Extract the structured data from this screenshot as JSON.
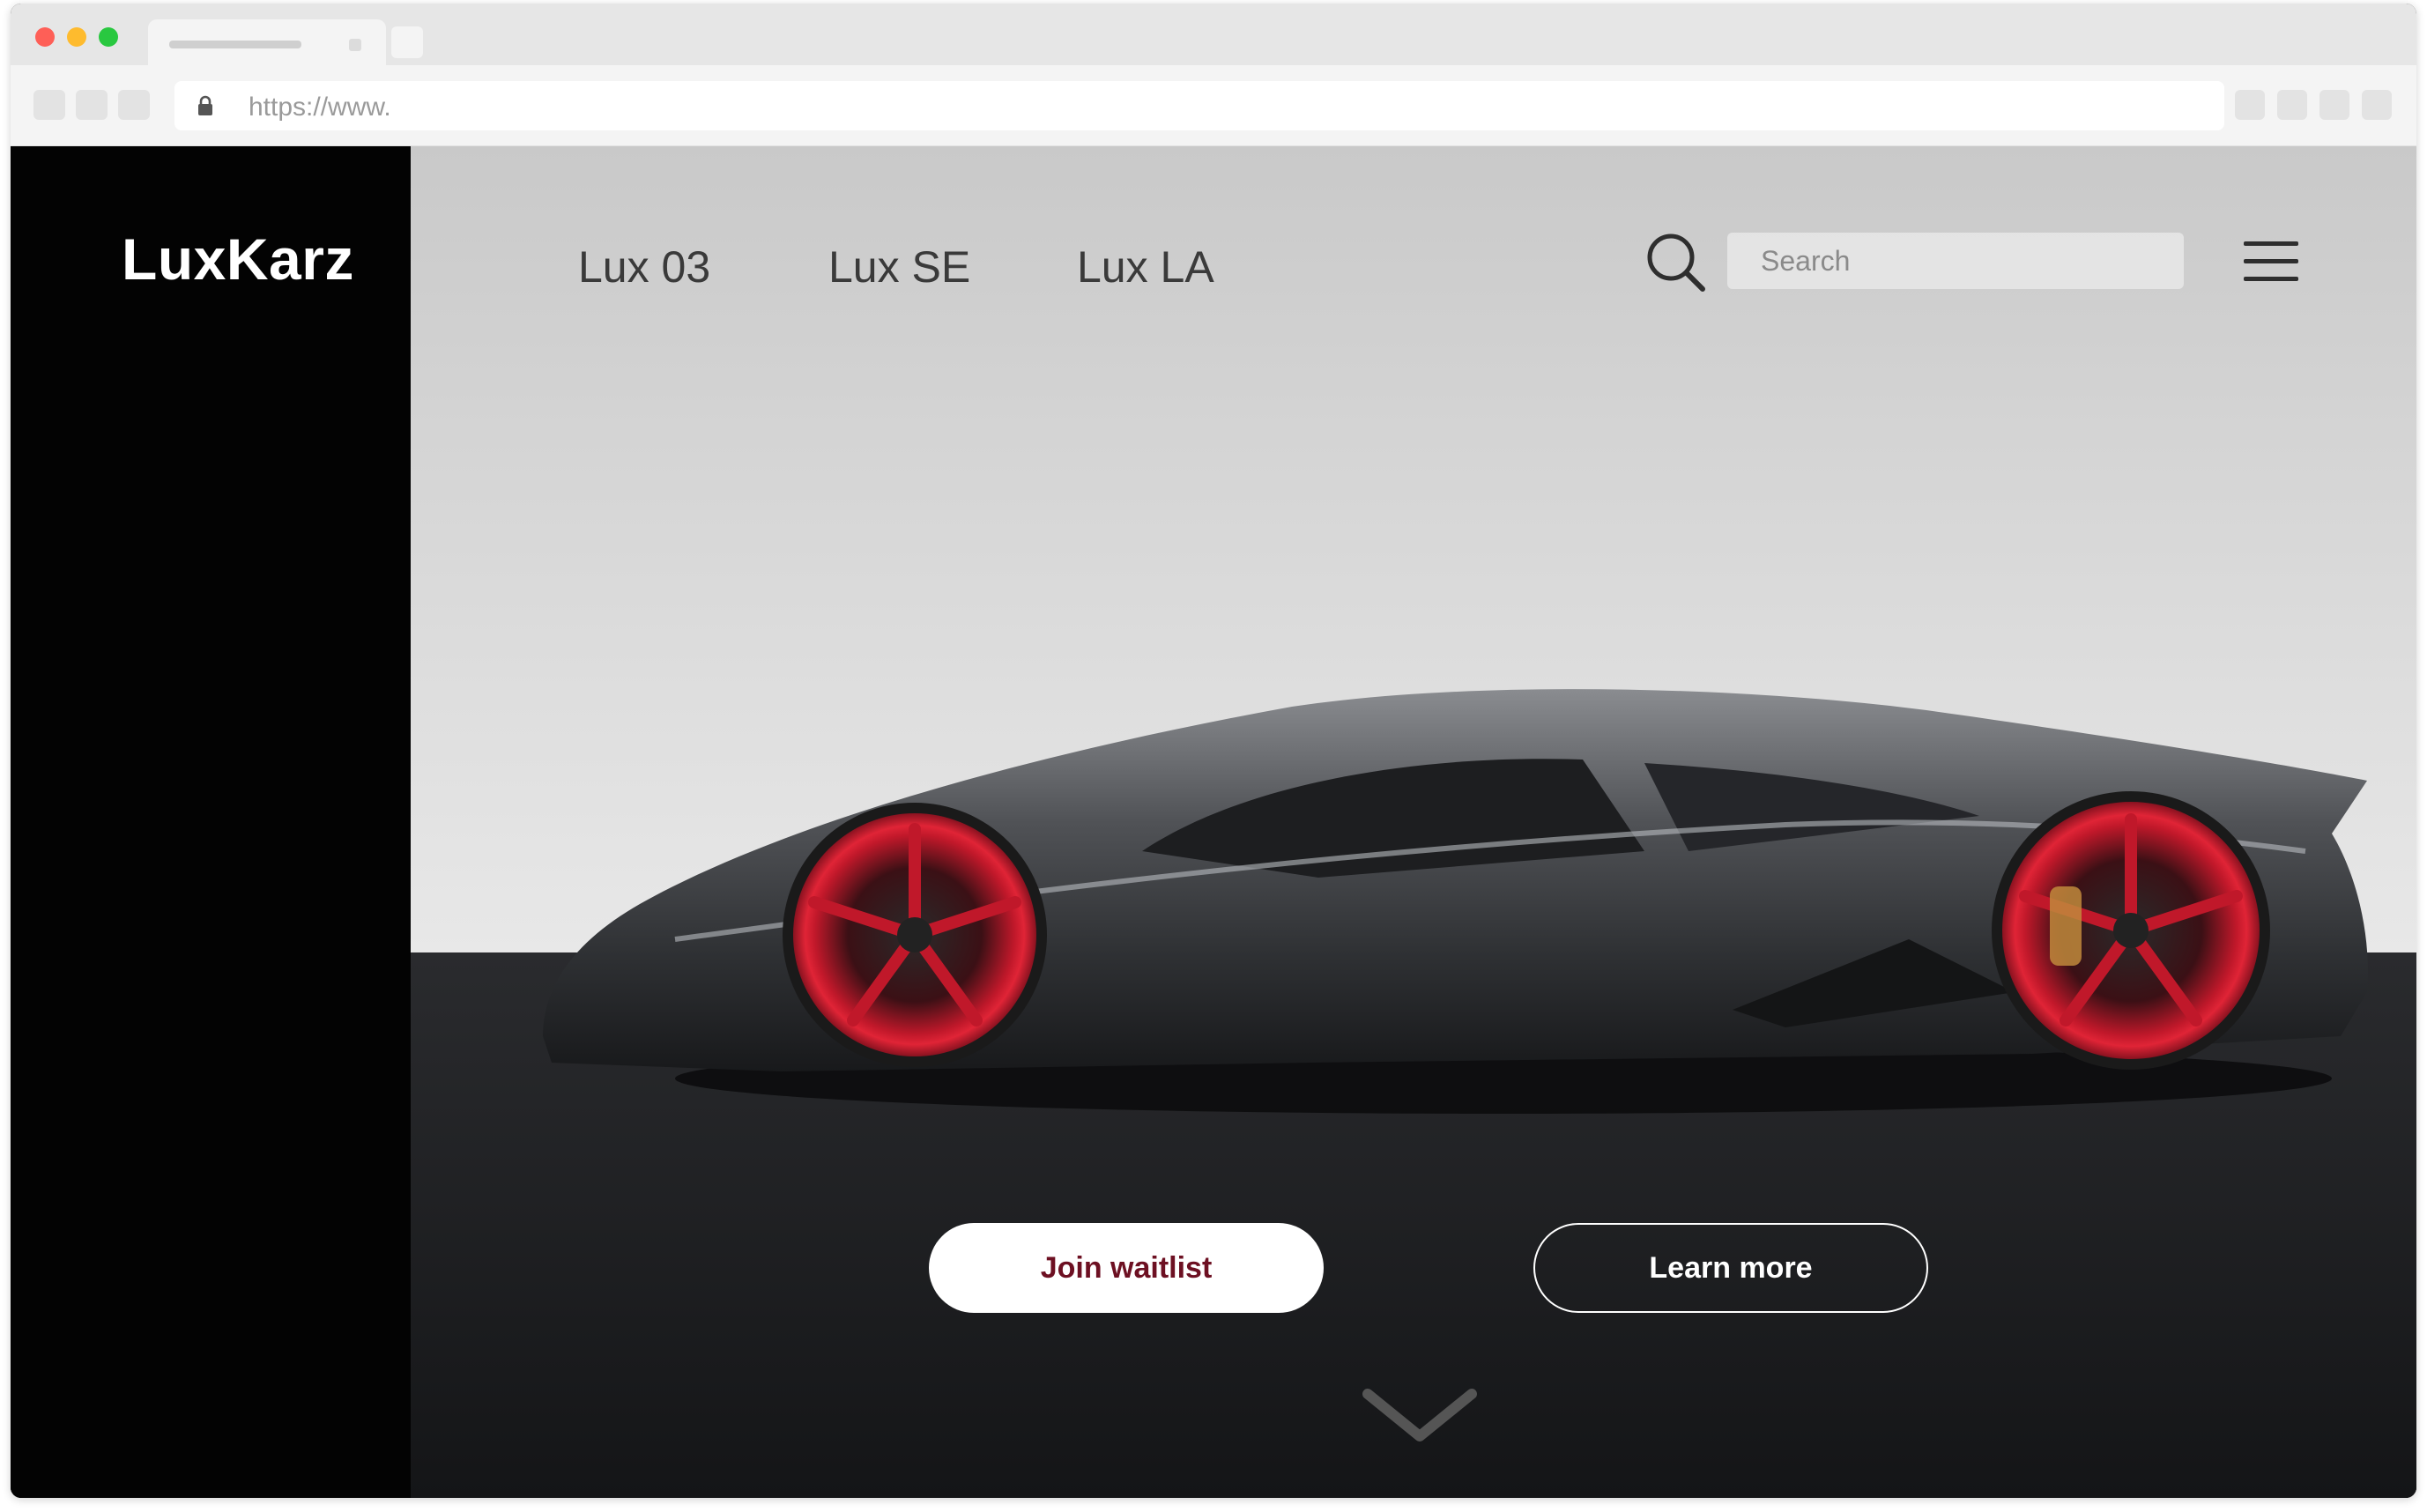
{
  "browser": {
    "url": "https://www.",
    "icons": {
      "lock": "lock-icon"
    }
  },
  "site": {
    "brand": "LuxKarz",
    "nav": [
      {
        "label": "Lux 03"
      },
      {
        "label": "Lux SE"
      },
      {
        "label": "Lux LA"
      }
    ],
    "search": {
      "placeholder": "Search",
      "icon": "search-icon"
    },
    "menu_icon": "hamburger-menu-icon"
  },
  "hero": {
    "image": "grey-sports-car-red-wheels",
    "buttons": {
      "primary": "Join waitlist",
      "secondary": "Learn more"
    },
    "scroll_icon": "chevron-down-icon"
  },
  "colors": {
    "sidebar": "#030303",
    "primary_button_text": "#6d1022",
    "wheel_accent": "#c0182a"
  }
}
